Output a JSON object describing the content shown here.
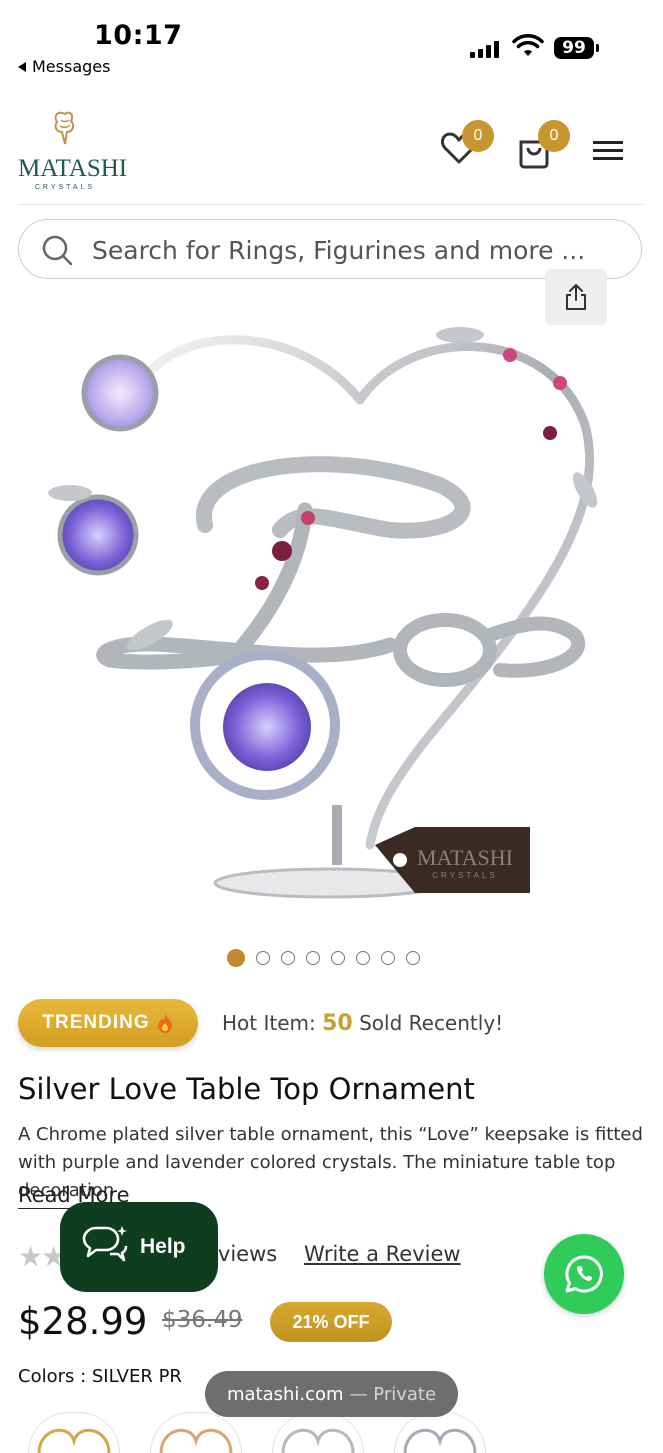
{
  "status_bar": {
    "time": "10:17",
    "back_app": "Messages",
    "battery": "99"
  },
  "header": {
    "logo": {
      "word": "MATASHI",
      "sub": "CRYSTALS"
    },
    "wishlist_count": "0",
    "cart_count": "0"
  },
  "search": {
    "placeholder": "Search for Rings, Figurines and more ..."
  },
  "image_watermark": {
    "word": "MATASHI",
    "sub": "CRYSTALS"
  },
  "carousel": {
    "total": 8,
    "active_index": 0
  },
  "trending": {
    "label": "TRENDING",
    "hot_prefix": "Hot Item:",
    "hot_count": "50",
    "hot_suffix": "Sold Recently!"
  },
  "product": {
    "title": "Silver Love Table Top Ornament",
    "description": "A Chrome plated silver table ornament, this “Love” keepsake is fitted with purple and lavender colored crystals. The miniature table top decoration",
    "read_more": "Read More",
    "reviews_text": "eviews",
    "write_review": "Write a Review",
    "rating_stars": 0,
    "price": "$28.99",
    "old_price": "$36.49",
    "discount": "21% OFF",
    "colors_label": "Colors : SILVER PR"
  },
  "help_button": {
    "label": "Help"
  },
  "browser": {
    "domain": "matashi.com",
    "mode": "— Private"
  },
  "colors": {
    "accent_gold": "#c8952f",
    "help_green": "#0f3d20",
    "whatsapp_green": "#2fcc5a",
    "logo_green": "#1e5a4e"
  }
}
